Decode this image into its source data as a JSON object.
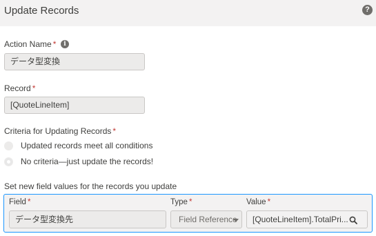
{
  "header": {
    "title": "Update Records",
    "help_icon": "?"
  },
  "action_name": {
    "label": "Action Name",
    "required_mark": "*",
    "info_icon": "i",
    "value": "データ型変換"
  },
  "record": {
    "label": "Record",
    "required_mark": "*",
    "value": "[QuoteLineItem]"
  },
  "criteria": {
    "label": "Criteria for Updating Records",
    "required_mark": "*",
    "options": [
      {
        "label": "Updated records meet all conditions",
        "selected": false
      },
      {
        "label": "No criteria—just update the records!",
        "selected": true
      }
    ]
  },
  "field_values": {
    "label": "Set new field values for the records you update",
    "field_label": "Field",
    "type_label": "Type",
    "value_label": "Value",
    "required_mark": "*",
    "field_value": "データ型変換先",
    "type_value": "Field Reference",
    "value_value": "[QuoteLineItem].TotalPri..."
  },
  "colors": {
    "accent": "#1b96ff",
    "required": "#c23934",
    "input_bg": "#ecebea"
  }
}
